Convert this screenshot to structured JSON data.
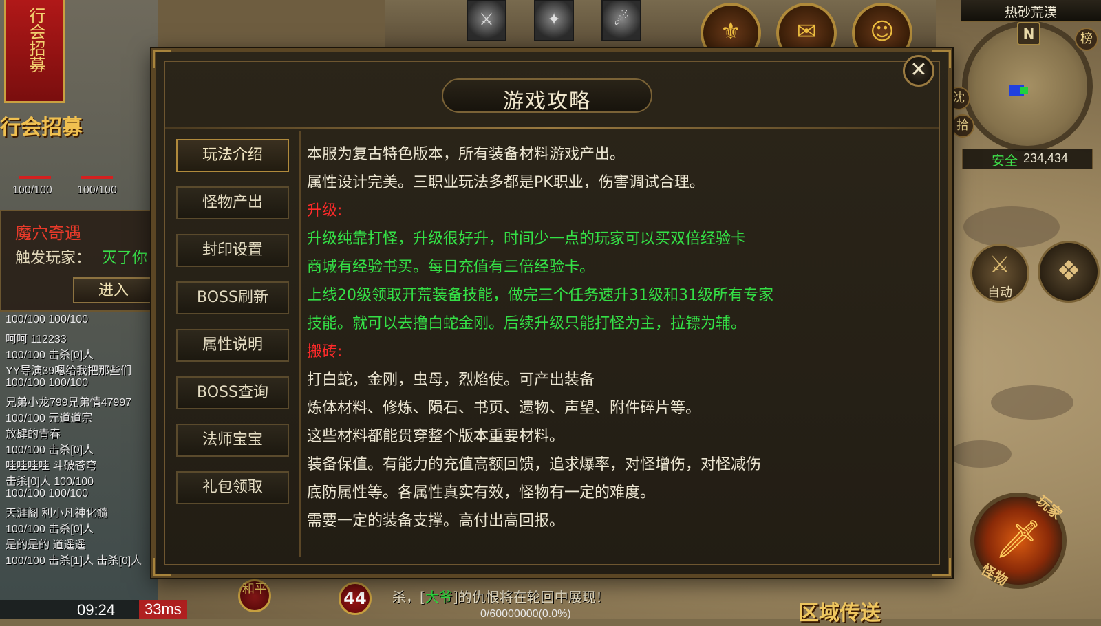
{
  "banner": {
    "text": "行会招募",
    "caption": "行会招募"
  },
  "left_panel": {
    "hp_labels": [
      "100/100",
      "100/100"
    ],
    "event": {
      "title": "魔穴奇遇",
      "trigger_label": "触发玩家：",
      "trigger_value": "灭了你",
      "enter_label": "进入"
    },
    "chat": [
      {
        "text": "100/100   100/100",
        "color": "#e8e8e8"
      },
      {
        "text": "呵呵       112233",
        "color": "#e8e8e8"
      },
      {
        "text": "100/100   击杀[0]人",
        "color": "#e8e8e8"
      },
      {
        "text": "YY导演39嗯给我把那些们",
        "color": "#e8e8e8"
      },
      {
        "text": "100/100   100/100",
        "color": "#e8e8e8"
      },
      {
        "text": "兄弟小龙799兄弟情47997",
        "color": "#e8e8e8"
      },
      {
        "text": "100/100   元道道宗",
        "color": "#e8e8e8"
      },
      {
        "text": "放肆的青春",
        "color": "#e8e8e8"
      },
      {
        "text": "100/100   击杀[0]人",
        "color": "#e8e8e8"
      },
      {
        "text": "哇哇哇哇   斗破苍穹",
        "color": "#e8e8e8"
      },
      {
        "text": "击杀[0]人   100/100",
        "color": "#e8e8e8"
      },
      {
        "text": "100/100   100/100",
        "color": "#e8e8e8"
      },
      {
        "text": "天涯阁     利小凡神化髓",
        "color": "#e8e8e8"
      },
      {
        "text": "100/100   击杀[0]人",
        "color": "#e8e8e8"
      },
      {
        "text": "是的是的   道遥遥",
        "color": "#e8e8e8"
      },
      {
        "text": "100/100   击杀[1]人   击杀[0]人",
        "color": "#e8e8e8"
      }
    ]
  },
  "top_hud": {
    "skills": [
      "⚔",
      "✦",
      "☄"
    ],
    "round_buttons": [
      "⚜",
      "✉",
      "☺"
    ]
  },
  "minimap": {
    "map_name": "热砂荒漠",
    "compass": "N",
    "chips": [
      "榜",
      "沈",
      "拾"
    ],
    "safe_label": "安全",
    "coords": "234,434"
  },
  "right_hud": {
    "auto_label": "自动",
    "attack_tags": [
      "玩家",
      "怪物"
    ]
  },
  "bottom_hud": {
    "time": "09:24",
    "ping": "33ms",
    "level": "44",
    "peace": "和平",
    "sys_msg_prefix": "杀，[",
    "sys_msg_name": "大爷",
    "sys_msg_suffix": "]的仇恨将在轮回中展现！",
    "exp": "0/60000000(0.0%)",
    "teleport": "区域传送"
  },
  "dialog": {
    "title": "游戏攻略",
    "close_label": "✕",
    "tabs": [
      {
        "label": "玩法介绍",
        "active": true
      },
      {
        "label": "怪物产出",
        "active": false
      },
      {
        "label": "封印设置",
        "active": false
      },
      {
        "label": "BOSS刷新",
        "active": false
      },
      {
        "label": "属性说明",
        "active": false
      },
      {
        "label": "BOSS查询",
        "active": false
      },
      {
        "label": "法师宝宝",
        "active": false
      },
      {
        "label": "礼包领取",
        "active": false
      }
    ],
    "lines": [
      {
        "text": "本服为复古特色版本，所有装备材料游戏产出。",
        "style": "white"
      },
      {
        "text": "属性设计完美。三职业玩法多都是PK职业，伤害调试合理。",
        "style": "white"
      },
      {
        "text": "升级:",
        "style": "red"
      },
      {
        "text": "升级纯靠打怪，升级很好升，时间少一点的玩家可以买双倍经验卡",
        "style": "green"
      },
      {
        "text": "商城有经验书买。每日充值有三倍经验卡。",
        "style": "green"
      },
      {
        "text": "上线20级领取开荒装备技能，做完三个任务速升31级和31级所有专家",
        "style": "green"
      },
      {
        "text": "技能。就可以去撸白蛇金刚。后续升级只能打怪为主，拉镖为辅。",
        "style": "green"
      },
      {
        "text": "搬砖:",
        "style": "red"
      },
      {
        "text": "打白蛇，金刚，虫母，烈焰使。可产出装备",
        "style": "white"
      },
      {
        "text": "炼体材料、修炼、陨石、书页、遗物、声望、附件碎片等。",
        "style": "white"
      },
      {
        "text": "这些材料都能贯穿整个版本重要材料。",
        "style": "white"
      },
      {
        "text": "装备保值。有能力的充值高额回馈，追求爆率，对怪增伤，对怪减伤",
        "style": "white"
      },
      {
        "text": "底防属性等。各属性真实有效，怪物有一定的难度。",
        "style": "white"
      },
      {
        "text": "需要一定的装备支撑。高付出高回报。",
        "style": "white"
      }
    ]
  }
}
